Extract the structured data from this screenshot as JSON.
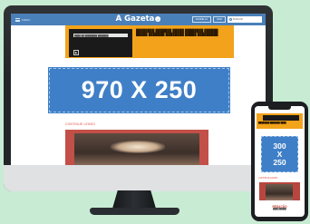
{
  "site": {
    "menu_label": "MENU",
    "brand": "A Gazeta",
    "brand_badge": "✓",
    "actions": [
      "ASSINE JÁ",
      "SAIR"
    ],
    "search_placeholder": "BUSCAR"
  },
  "promo": {
    "video_bar": "████ ██ ████████ ███████",
    "play_glyph": "▶",
    "text": "████████ ███████ █████ ████████ ██████ █████ ███████ ████████ █████ █████████"
  },
  "banner_desktop": {
    "label": "970 X 250"
  },
  "section_label": "CONTINUE LENDO",
  "phone": {
    "promo_text": "████████ ███████ ████",
    "banner_lines": [
      "300",
      "X",
      "250"
    ],
    "section_label": "CONTINUE LENDO",
    "footer_logo": "REDAÇÃO",
    "footer_sub": "████ ██████"
  },
  "colors": {
    "background": "#c8ebd4",
    "header_blue": "#4a80b9",
    "ad_blue": "#3f7fc7",
    "promo_orange": "#f2a31b",
    "accent_red": "#e04b3f"
  }
}
